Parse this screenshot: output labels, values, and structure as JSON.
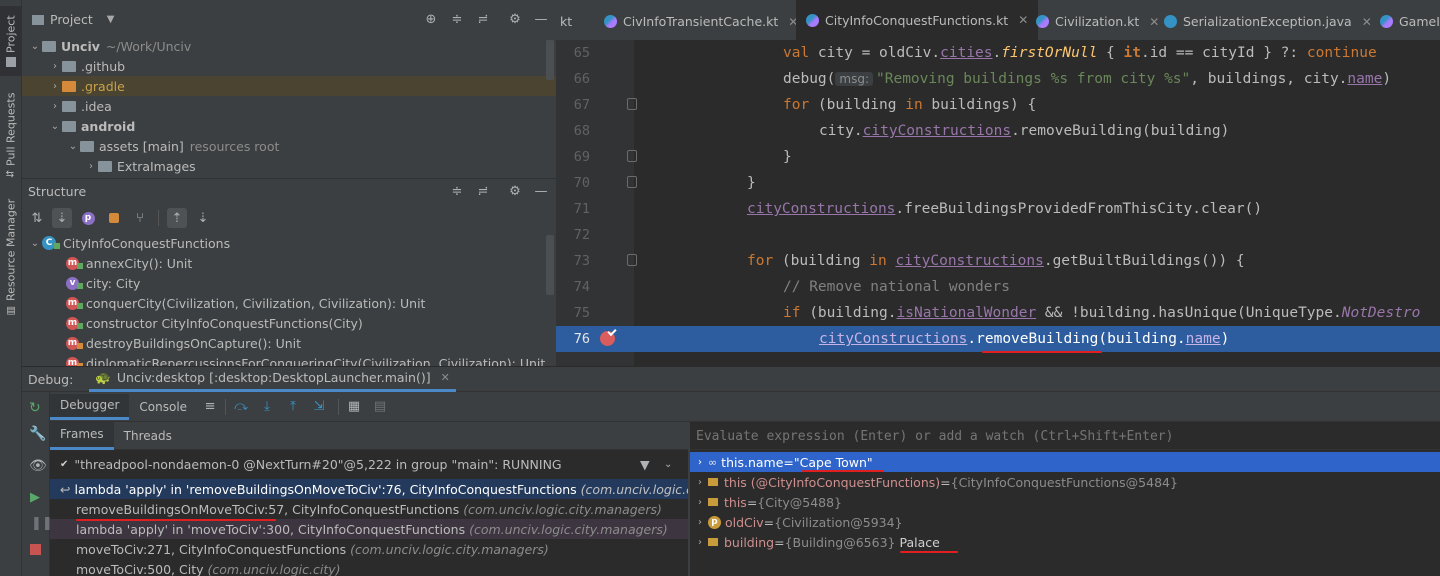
{
  "left_strip": {
    "project_label": "Project",
    "pull_requests_label": "Pull Requests",
    "resource_manager_label": "Resource Manager"
  },
  "project_panel": {
    "title": "Project",
    "tree": [
      {
        "label": "Unciv",
        "extra": "~/Work/Unciv"
      },
      {
        "label": ".github"
      },
      {
        "label": ".gradle"
      },
      {
        "label": ".idea"
      },
      {
        "label": "android"
      },
      {
        "label": "assets [main]",
        "extra": "resources root"
      },
      {
        "label": "ExtraImages"
      }
    ]
  },
  "structure_panel": {
    "title": "Structure",
    "root": "CityInfoConquestFunctions",
    "items": [
      {
        "badge": "m",
        "label": "annexCity(): Unit"
      },
      {
        "badge": "v",
        "label": "city: City"
      },
      {
        "badge": "m",
        "label": "conquerCity(Civilization, Civilization, Civilization): Unit"
      },
      {
        "badge": "m",
        "label": "constructor CityInfoConquestFunctions(City)"
      },
      {
        "badge": "m",
        "label": "destroyBuildingsOnCapture(): Unit"
      },
      {
        "badge": "m",
        "label": "diplomaticRepercussionsForConqueringCity(Civilization, Civilization): Unit"
      }
    ]
  },
  "editor_tabs": [
    {
      "label": "kt",
      "active": false
    },
    {
      "label": "CivInfoTransientCache.kt",
      "active": false
    },
    {
      "label": "CityInfoConquestFunctions.kt",
      "active": true
    },
    {
      "label": "Civilization.kt",
      "active": false
    },
    {
      "label": "SerializationException.java",
      "active": false
    },
    {
      "label": "GameIn",
      "active": false
    }
  ],
  "code": {
    "line_numbers": [
      "65",
      "66",
      "67",
      "68",
      "69",
      "70",
      "71",
      "72",
      "73",
      "74",
      "75",
      "76"
    ],
    "l65_val": "val ",
    "l65_city": "city = oldCiv.",
    "l65_cities": "cities",
    "l65_dot": ".",
    "l65_first": "firstOrNull",
    "l65_brace": " { ",
    "l65_it": "it",
    "l65_id": ".id",
    "l65_eq": " == cityId } ?: ",
    "l65_continue": "continue",
    "l66_debug": "debug(",
    "l66_hint": "msg:",
    "l66_str": "\"Removing buildings %s from city %s\"",
    "l66_sep": ", buildings, city.",
    "l66_name": "name",
    "l66_end": ")",
    "l67_for": "for",
    "l67_rest": " (building ",
    "l67_in": "in",
    "l67_end": " buildings) {",
    "l68_city": "city.",
    "l68_cc": "cityConstructions",
    "l68_rest": ".removeBuilding(building)",
    "l69": "}",
    "l70": "}",
    "l71_cc": "cityConstructions",
    "l71_rest": ".freeBuildingsProvidedFromThisCity.clear()",
    "l73_for": "for",
    "l73_a": " (building ",
    "l73_in": "in",
    "l73_sp": " ",
    "l73_cc": "cityConstructions",
    "l73_rest": ".getBuiltBuildings()) {",
    "l74": "// Remove national wonders",
    "l75_if": "if",
    "l75_a": " (building.",
    "l75_nw": "isNationalWonder",
    "l75_b": " && !building.hasUnique(UniqueType.",
    "l75_nd": "NotDestro",
    "l76_cc": "cityConstructions",
    "l76_dot": ".",
    "l76_rb": "removeBuilding",
    "l76_a": "(building.",
    "l76_name": "name",
    "l76_end": ")"
  },
  "debug": {
    "label": "Debug:",
    "session": "Unciv:desktop [:desktop:DesktopLauncher.main()]",
    "tabs": [
      "Debugger",
      "Console"
    ],
    "subtabs": [
      "Frames",
      "Threads"
    ],
    "thread": "\"threadpool-nondaemon-0 @NextTurn#20\"@5,222 in group \"main\": RUNNING",
    "frames": [
      {
        "method": "lambda 'apply' in 'removeBuildingsOnMoveToCiv':76, CityInfoConquestFunctions",
        "pkg": "(com.unciv.logic.city.ma"
      },
      {
        "method": "removeBuildingsOnMoveToCiv:57, CityInfoConquestFunctions",
        "pkg": "(com.unciv.logic.city.managers)"
      },
      {
        "method": "lambda 'apply' in 'moveToCiv':300, CityInfoConquestFunctions",
        "pkg": "(com.unciv.logic.city.managers)"
      },
      {
        "method": "moveToCiv:271, CityInfoConquestFunctions",
        "pkg": "(com.unciv.logic.city.managers)"
      },
      {
        "method": "moveToCiv:500, City",
        "pkg": "(com.unciv.logic.city)"
      }
    ],
    "eval_placeholder": "Evaluate expression (Enter) or add a watch (Ctrl+Shift+Enter)",
    "variables": [
      {
        "name": "this.name",
        "eq": " = ",
        "value": "\"Cape Town\"",
        "icon": "watch-icon"
      },
      {
        "name": "this (@CityInfoConquestFunctions)",
        "eq": " = ",
        "value": "{CityInfoConquestFunctions@5484}",
        "icon": "field-icon"
      },
      {
        "name": "this",
        "eq": " = ",
        "value": "{City@5488}",
        "icon": "field-icon"
      },
      {
        "name": "oldCiv",
        "eq": " = ",
        "value": "{Civilization@5934}",
        "icon": "param-icon"
      },
      {
        "name": "building",
        "eq": " = ",
        "value": "{Building@6563}",
        "extra": "Palace",
        "icon": "field-icon"
      }
    ]
  },
  "colors": {
    "selection": "#2f65ca",
    "accent": "#4a88c7",
    "annotation": "#e02020"
  }
}
